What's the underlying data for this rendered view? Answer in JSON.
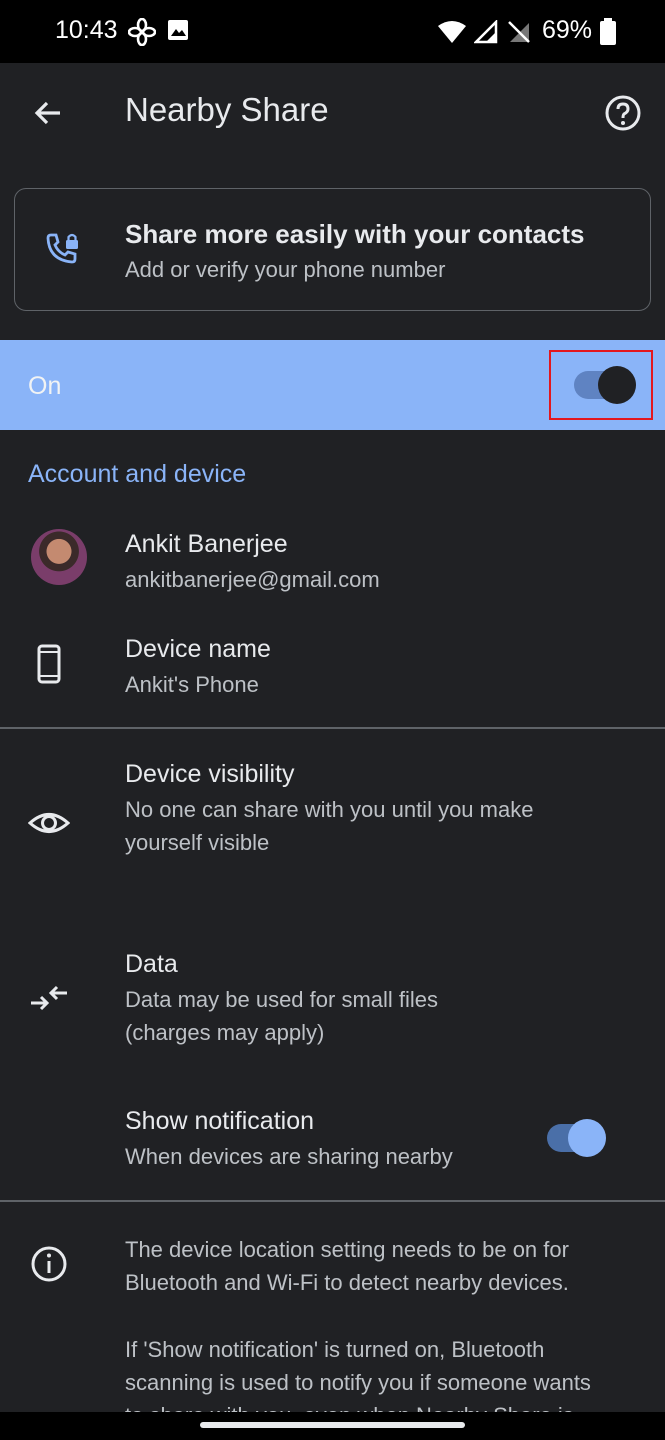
{
  "status_bar": {
    "time": "10:43",
    "battery": "69%",
    "icons": [
      "fan-icon",
      "image-icon",
      "wifi-icon",
      "signal-icon",
      "no-sim-icon",
      "battery-icon"
    ]
  },
  "app_bar": {
    "title": "Nearby Share",
    "back_icon": "arrow-back-icon",
    "help_icon": "help-icon"
  },
  "contact_card": {
    "title": "Share more easily with your contacts",
    "subtitle": "Add or verify your phone number",
    "icon": "phone-lock-icon"
  },
  "main_switch": {
    "label": "On",
    "state": true,
    "highlighted": true
  },
  "account_section": {
    "header": "Account and device",
    "account": {
      "name": "Ankit Banerjee",
      "email": "ankitbanerjee@gmail.com"
    },
    "device": {
      "title": "Device name",
      "value": "Ankit's Phone"
    }
  },
  "settings": {
    "visibility": {
      "title": "Device visibility",
      "line1": "No one can share with you until you make",
      "line2": "yourself visible"
    },
    "data": {
      "title": "Data",
      "line1": "Data may be used for small files",
      "line2": "(charges may apply)"
    },
    "notification": {
      "title": "Show notification",
      "subtitle": "When devices are sharing nearby",
      "state": true
    }
  },
  "info": {
    "para1_line1": "The device location setting needs to be on for",
    "para1_line2": "Bluetooth and Wi-Fi to detect nearby devices.",
    "para2_line1": "If 'Show notification' is turned on, Bluetooth",
    "para2_line2": "scanning is used to notify you if someone wants",
    "para2_line3": "to share with you, even when Nearby Share is"
  },
  "colors": {
    "background": "#202124",
    "accent": "#8ab4f8",
    "highlight_box": "#e3171d"
  }
}
